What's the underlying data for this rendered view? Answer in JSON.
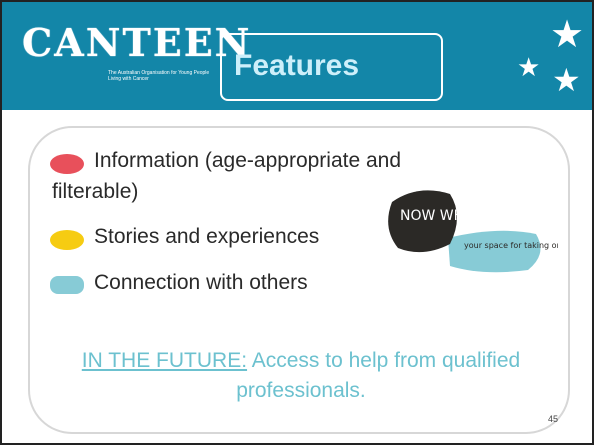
{
  "header": {
    "logo_text": "CANTEEN",
    "logo_tagline": "The Australian Organisation for Young People Living with Cancer",
    "title": "Features"
  },
  "features": [
    {
      "label": "Information (age-appropriate and",
      "label2": "filterable)",
      "color": "#e8505b"
    },
    {
      "label": "Stories and experiences",
      "color": "#f6cc12"
    },
    {
      "label": "Connection with others",
      "color": "#87cbd6"
    }
  ],
  "future": {
    "prefix": "IN THE FUTURE:",
    "text": " Access to help from qualified",
    "text2": "professionals."
  },
  "badge": {
    "main": "NOW WHAT",
    "sub": "your space for taking on cancer"
  },
  "page_number": "45",
  "colors": {
    "header_bg": "#1386a8",
    "title_fill": "#cdeffa",
    "future_text": "#6cc1cf"
  }
}
